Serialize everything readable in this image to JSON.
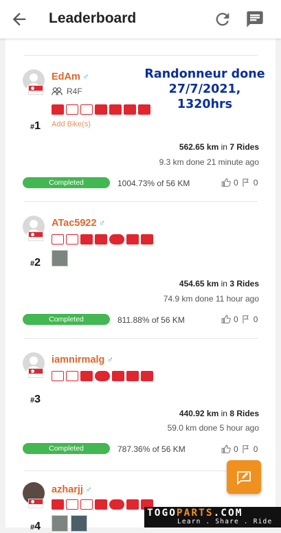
{
  "appbar": {
    "title": "Leaderboard",
    "icons": [
      "back-arrow-icon",
      "refresh-icon",
      "chat-icon"
    ]
  },
  "overlay": {
    "line1": "Randonneur done",
    "line2": "27/7/2021,",
    "line3": "1320hrs"
  },
  "entries": [
    {
      "username": "EdAm",
      "gender": "♂",
      "group": "R4F",
      "add_bike": "Add Bike(s)",
      "rank_prefix": "#",
      "rank": "1",
      "distance": "562.65 km",
      "in": "in",
      "rides": "7 Rides",
      "last_ride": "9.3 km done 21 minute ago",
      "status": "Completed",
      "progress": "1004.73% of 56 KM",
      "likes": "0",
      "flags": "0"
    },
    {
      "username": "ATac5922",
      "gender": "♂",
      "rank_prefix": "#",
      "rank": "2",
      "distance": "454.65 km",
      "in": "in",
      "rides": "3 Rides",
      "last_ride": "74.9 km done 11 hour ago",
      "status": "Completed",
      "progress": "811.88% of 56 KM",
      "likes": "0",
      "flags": "0"
    },
    {
      "username": "iamnirmalg",
      "gender": "♂",
      "rank_prefix": "#",
      "rank": "3",
      "distance": "440.92 km",
      "in": "in",
      "rides": "8 Rides",
      "last_ride": "59.0 km done 5 hour ago",
      "status": "Completed",
      "progress": "787.36% of 56 KM",
      "likes": "0",
      "flags": "0"
    },
    {
      "username": "azharjj",
      "gender": "♂",
      "rank_prefix": "#",
      "rank": "4"
    }
  ],
  "fab": {
    "icon": "compose-message-icon"
  },
  "watermark": {
    "brand_a": "TOGO",
    "brand_b": "PARTS",
    "brand_c": ".COM",
    "tagline": "Learn . Share . Ride"
  },
  "colors": {
    "accent": "#e0662a",
    "completed": "#43b751",
    "badge": "#e0262e",
    "fab": "#f0901f",
    "overlay_text": "#0a2f9c"
  }
}
